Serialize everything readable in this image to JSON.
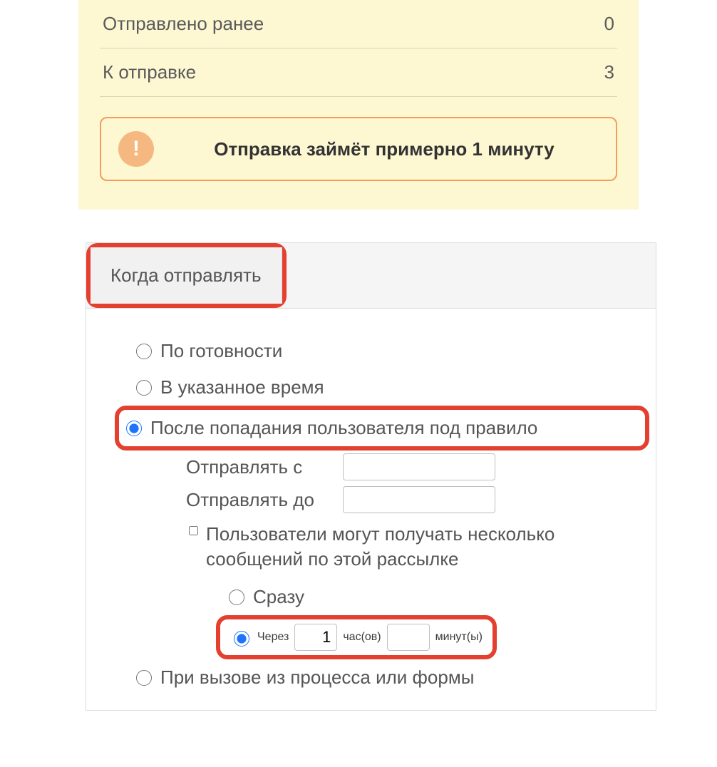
{
  "summary": {
    "rows": [
      {
        "label": "Отправлено ранее",
        "value": "0"
      },
      {
        "label": "К отправке",
        "value": "3"
      }
    ],
    "info": "Отправка займёт примерно 1 минуту"
  },
  "when": {
    "tab_label": "Когда отправлять",
    "options": {
      "ready": "По готовности",
      "at_time": "В указанное время",
      "after_rule": "После попадания пользователя под правило",
      "from_process": "При вызове из процесса или формы"
    },
    "after_rule_fields": {
      "send_from_label": "Отправлять с",
      "send_from_value": "",
      "send_to_label": "Отправлять до",
      "send_to_value": "",
      "multi_label": "Пользователи могут получать несколько сообщений по этой рассылке",
      "immediate_label": "Сразу",
      "delay_prefix": "Через",
      "delay_hours_value": "1",
      "delay_hours_label": "час(ов)",
      "delay_minutes_value": "",
      "delay_minutes_label": "минут(ы)"
    }
  }
}
